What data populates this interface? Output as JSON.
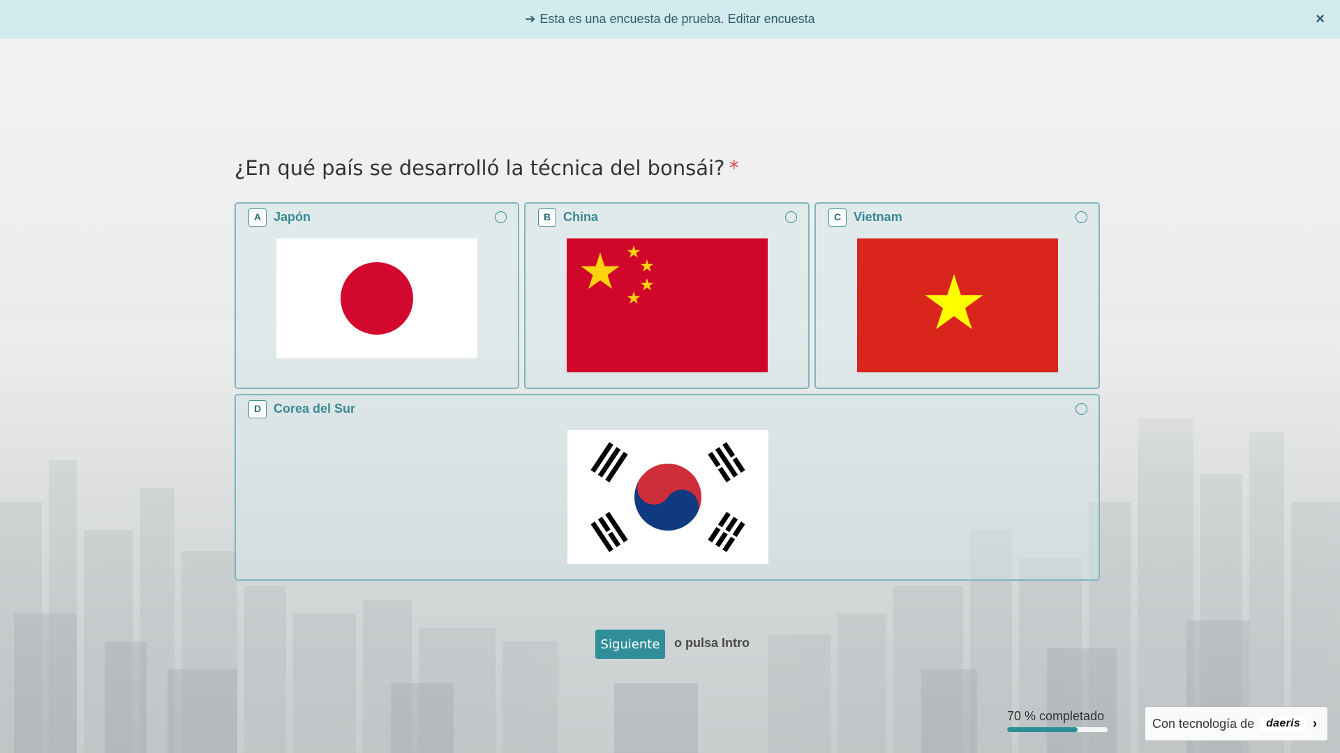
{
  "banner": {
    "text": "Esta es una encuesta de prueba. Editar encuesta",
    "close_glyph": "×"
  },
  "question": {
    "text": "¿En qué país se desarrolló la técnica del bonsái?",
    "required_mark": "*"
  },
  "options": [
    {
      "key": "A",
      "label": "Japón",
      "flag_icon": "japan-flag"
    },
    {
      "key": "B",
      "label": "China",
      "flag_icon": "china-flag"
    },
    {
      "key": "C",
      "label": "Vietnam",
      "flag_icon": "vietnam-flag"
    },
    {
      "key": "D",
      "label": "Corea del Sur",
      "flag_icon": "south-korea-flag"
    }
  ],
  "navigation": {
    "next_label": "Siguiente",
    "enter_hint": "o pulsa Intro"
  },
  "progress": {
    "label": "70 % completado",
    "percent": 70
  },
  "footer": {
    "powered_text": "Con tecnología de",
    "brand": "daeris",
    "chevron": "›"
  },
  "colors": {
    "accent": "#2f8e99",
    "banner_bg": "#d2e9ed",
    "required": "#d9534f"
  }
}
